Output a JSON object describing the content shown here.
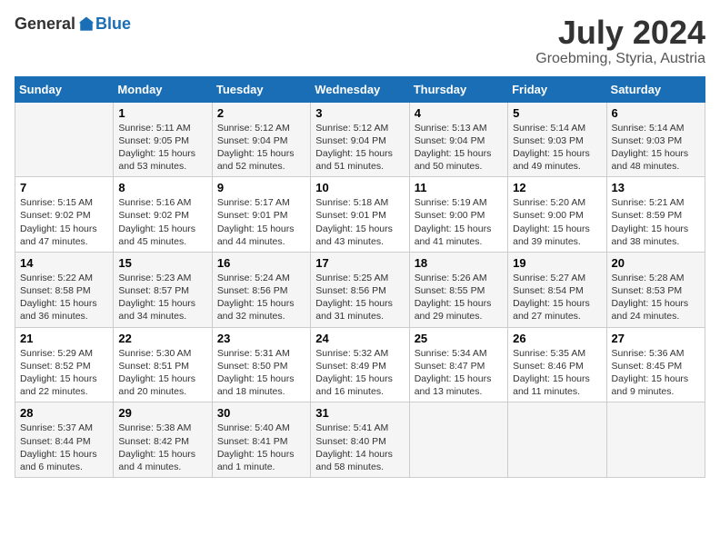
{
  "header": {
    "logo_general": "General",
    "logo_blue": "Blue",
    "month": "July 2024",
    "location": "Groebming, Styria, Austria"
  },
  "days_of_week": [
    "Sunday",
    "Monday",
    "Tuesday",
    "Wednesday",
    "Thursday",
    "Friday",
    "Saturday"
  ],
  "weeks": [
    [
      {
        "day": "",
        "info": ""
      },
      {
        "day": "1",
        "info": "Sunrise: 5:11 AM\nSunset: 9:05 PM\nDaylight: 15 hours\nand 53 minutes."
      },
      {
        "day": "2",
        "info": "Sunrise: 5:12 AM\nSunset: 9:04 PM\nDaylight: 15 hours\nand 52 minutes."
      },
      {
        "day": "3",
        "info": "Sunrise: 5:12 AM\nSunset: 9:04 PM\nDaylight: 15 hours\nand 51 minutes."
      },
      {
        "day": "4",
        "info": "Sunrise: 5:13 AM\nSunset: 9:04 PM\nDaylight: 15 hours\nand 50 minutes."
      },
      {
        "day": "5",
        "info": "Sunrise: 5:14 AM\nSunset: 9:03 PM\nDaylight: 15 hours\nand 49 minutes."
      },
      {
        "day": "6",
        "info": "Sunrise: 5:14 AM\nSunset: 9:03 PM\nDaylight: 15 hours\nand 48 minutes."
      }
    ],
    [
      {
        "day": "7",
        "info": "Sunrise: 5:15 AM\nSunset: 9:02 PM\nDaylight: 15 hours\nand 47 minutes."
      },
      {
        "day": "8",
        "info": "Sunrise: 5:16 AM\nSunset: 9:02 PM\nDaylight: 15 hours\nand 45 minutes."
      },
      {
        "day": "9",
        "info": "Sunrise: 5:17 AM\nSunset: 9:01 PM\nDaylight: 15 hours\nand 44 minutes."
      },
      {
        "day": "10",
        "info": "Sunrise: 5:18 AM\nSunset: 9:01 PM\nDaylight: 15 hours\nand 43 minutes."
      },
      {
        "day": "11",
        "info": "Sunrise: 5:19 AM\nSunset: 9:00 PM\nDaylight: 15 hours\nand 41 minutes."
      },
      {
        "day": "12",
        "info": "Sunrise: 5:20 AM\nSunset: 9:00 PM\nDaylight: 15 hours\nand 39 minutes."
      },
      {
        "day": "13",
        "info": "Sunrise: 5:21 AM\nSunset: 8:59 PM\nDaylight: 15 hours\nand 38 minutes."
      }
    ],
    [
      {
        "day": "14",
        "info": "Sunrise: 5:22 AM\nSunset: 8:58 PM\nDaylight: 15 hours\nand 36 minutes."
      },
      {
        "day": "15",
        "info": "Sunrise: 5:23 AM\nSunset: 8:57 PM\nDaylight: 15 hours\nand 34 minutes."
      },
      {
        "day": "16",
        "info": "Sunrise: 5:24 AM\nSunset: 8:56 PM\nDaylight: 15 hours\nand 32 minutes."
      },
      {
        "day": "17",
        "info": "Sunrise: 5:25 AM\nSunset: 8:56 PM\nDaylight: 15 hours\nand 31 minutes."
      },
      {
        "day": "18",
        "info": "Sunrise: 5:26 AM\nSunset: 8:55 PM\nDaylight: 15 hours\nand 29 minutes."
      },
      {
        "day": "19",
        "info": "Sunrise: 5:27 AM\nSunset: 8:54 PM\nDaylight: 15 hours\nand 27 minutes."
      },
      {
        "day": "20",
        "info": "Sunrise: 5:28 AM\nSunset: 8:53 PM\nDaylight: 15 hours\nand 24 minutes."
      }
    ],
    [
      {
        "day": "21",
        "info": "Sunrise: 5:29 AM\nSunset: 8:52 PM\nDaylight: 15 hours\nand 22 minutes."
      },
      {
        "day": "22",
        "info": "Sunrise: 5:30 AM\nSunset: 8:51 PM\nDaylight: 15 hours\nand 20 minutes."
      },
      {
        "day": "23",
        "info": "Sunrise: 5:31 AM\nSunset: 8:50 PM\nDaylight: 15 hours\nand 18 minutes."
      },
      {
        "day": "24",
        "info": "Sunrise: 5:32 AM\nSunset: 8:49 PM\nDaylight: 15 hours\nand 16 minutes."
      },
      {
        "day": "25",
        "info": "Sunrise: 5:34 AM\nSunset: 8:47 PM\nDaylight: 15 hours\nand 13 minutes."
      },
      {
        "day": "26",
        "info": "Sunrise: 5:35 AM\nSunset: 8:46 PM\nDaylight: 15 hours\nand 11 minutes."
      },
      {
        "day": "27",
        "info": "Sunrise: 5:36 AM\nSunset: 8:45 PM\nDaylight: 15 hours\nand 9 minutes."
      }
    ],
    [
      {
        "day": "28",
        "info": "Sunrise: 5:37 AM\nSunset: 8:44 PM\nDaylight: 15 hours\nand 6 minutes."
      },
      {
        "day": "29",
        "info": "Sunrise: 5:38 AM\nSunset: 8:42 PM\nDaylight: 15 hours\nand 4 minutes."
      },
      {
        "day": "30",
        "info": "Sunrise: 5:40 AM\nSunset: 8:41 PM\nDaylight: 15 hours\nand 1 minute."
      },
      {
        "day": "31",
        "info": "Sunrise: 5:41 AM\nSunset: 8:40 PM\nDaylight: 14 hours\nand 58 minutes."
      },
      {
        "day": "",
        "info": ""
      },
      {
        "day": "",
        "info": ""
      },
      {
        "day": "",
        "info": ""
      }
    ]
  ]
}
